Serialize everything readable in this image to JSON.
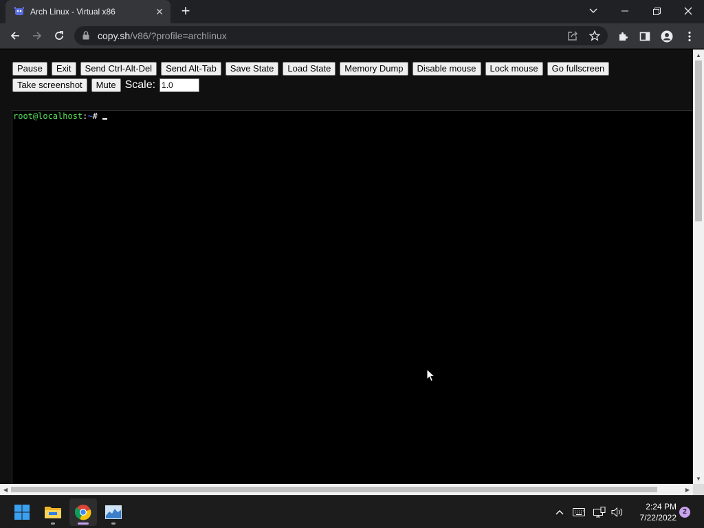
{
  "browser": {
    "tab_title": "Arch Linux - Virtual x86",
    "url_host": "copy.sh",
    "url_path": "/v86/?profile=archlinux"
  },
  "controls": {
    "row1": [
      "Pause",
      "Exit",
      "Send Ctrl-Alt-Del",
      "Send Alt-Tab",
      "Save State",
      "Load State",
      "Memory Dump",
      "Disable mouse",
      "Lock mouse",
      "Go fullscreen"
    ],
    "row2": [
      "Take screenshot",
      "Mute"
    ],
    "scale_label": "Scale:",
    "scale_value": "1.0"
  },
  "terminal": {
    "user_host": "root@localhost",
    "separator": ":",
    "cwd": "~",
    "prompt_char": "# "
  },
  "taskbar": {
    "time": "2:24 PM",
    "date": "7/22/2022",
    "notification_count": "2"
  },
  "colors": {
    "terminal_user": "#55e05a",
    "terminal_cwd": "#4a78ff",
    "accent": "#c9a3f0"
  }
}
